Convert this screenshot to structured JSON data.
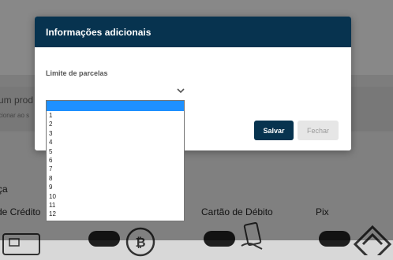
{
  "background": {
    "strip_title": "um prod",
    "strip_subtitle": "cionar ao s",
    "section_title": "ça",
    "payment_methods": [
      {
        "label": "de Crédito",
        "toggle_on": true
      },
      {
        "label": "Cartão de Débito",
        "toggle_on": true
      },
      {
        "label": "Pix",
        "toggle_on": true
      }
    ]
  },
  "modal": {
    "title": "Informações adicionais",
    "field_label": "Limite de parcelas",
    "selected_value": "",
    "save_label": "Salvar",
    "close_label": "Fechar"
  },
  "dropdown": {
    "options": [
      "",
      "1",
      "2",
      "3",
      "4",
      "5",
      "6",
      "7",
      "8",
      "9",
      "10",
      "11",
      "12"
    ],
    "highlighted_index": 0,
    "highlight_color": "#1e90ff"
  },
  "colors": {
    "header_bg": "#07334f",
    "primary_button": "#07334f"
  },
  "icons": [
    "chevron-down-icon",
    "card-icon",
    "bitcoin-icon",
    "card-hand-icon",
    "pix-icon"
  ]
}
